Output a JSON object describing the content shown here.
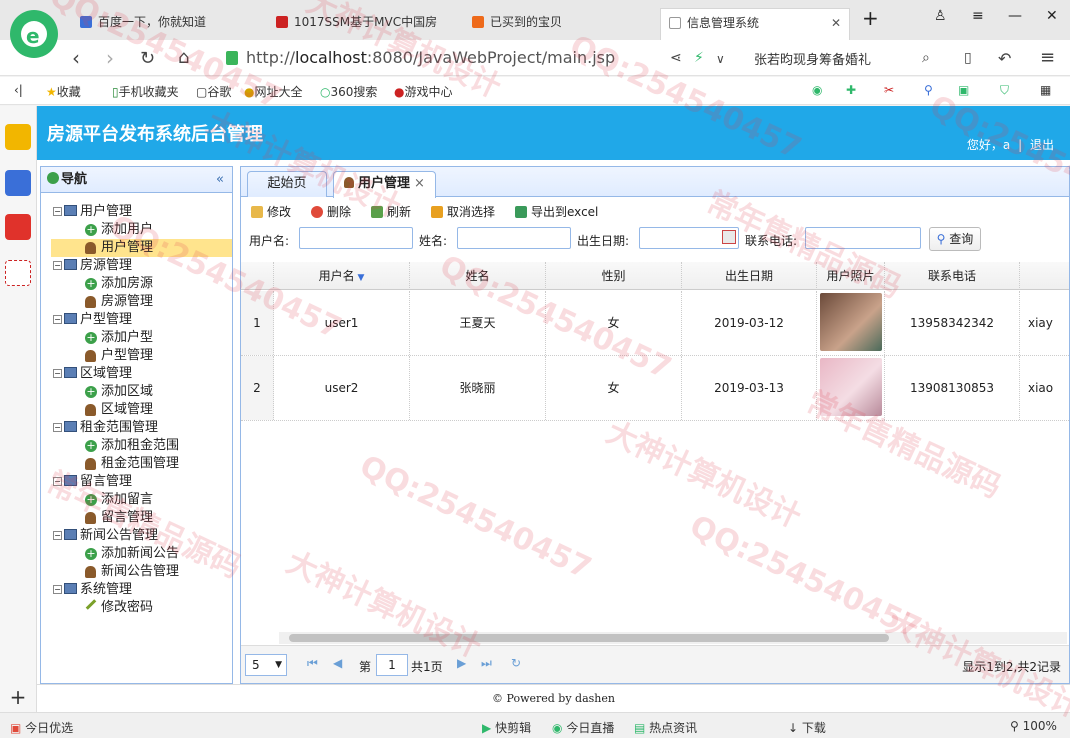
{
  "browser": {
    "tabs": [
      {
        "label": "百度一下，你就知道",
        "color": "#3a6fd8"
      },
      {
        "label": "1017SSM基于MVC中国房",
        "color": "#cc2222"
      },
      {
        "label": "已买到的宝贝",
        "color": "#ee6a1a"
      },
      {
        "label": "信息管理系统",
        "color": "#999999"
      }
    ],
    "url_prefix": "http://",
    "url_host": "localhost",
    "url_rest": ":8080/JavaWebProject/main.jsp",
    "search_suggestion": "张若昀现身筹备婚礼",
    "bookmarks": [
      "收藏",
      "手机收藏夹",
      "谷歌",
      "网址大全",
      "360搜索",
      "游戏中心"
    ]
  },
  "app": {
    "title": "房源平台发布系统后台管理",
    "greeting": "您好，a",
    "separator": "|",
    "logout": "退出"
  },
  "nav": {
    "header": "导航",
    "collapse": "«",
    "groups": [
      {
        "label": "用户管理",
        "children": [
          {
            "label": "添加用户",
            "icon": "add"
          },
          {
            "label": "用户管理",
            "icon": "user",
            "selected": true
          }
        ]
      },
      {
        "label": "房源管理",
        "children": [
          {
            "label": "添加房源",
            "icon": "add"
          },
          {
            "label": "房源管理",
            "icon": "user"
          }
        ]
      },
      {
        "label": "户型管理",
        "children": [
          {
            "label": "添加户型",
            "icon": "add"
          },
          {
            "label": "户型管理",
            "icon": "user"
          }
        ]
      },
      {
        "label": "区域管理",
        "children": [
          {
            "label": "添加区域",
            "icon": "add"
          },
          {
            "label": "区域管理",
            "icon": "user"
          }
        ]
      },
      {
        "label": "租金范围管理",
        "children": [
          {
            "label": "添加租金范围",
            "icon": "add"
          },
          {
            "label": "租金范围管理",
            "icon": "user"
          }
        ]
      },
      {
        "label": "留言管理",
        "children": [
          {
            "label": "添加留言",
            "icon": "add"
          },
          {
            "label": "留言管理",
            "icon": "user"
          }
        ]
      },
      {
        "label": "新闻公告管理",
        "children": [
          {
            "label": "添加新闻公告",
            "icon": "add"
          },
          {
            "label": "新闻公告管理",
            "icon": "user"
          }
        ]
      },
      {
        "label": "系统管理",
        "children": [
          {
            "label": "修改密码",
            "icon": "pen"
          }
        ]
      }
    ]
  },
  "tabs": {
    "home": "起始页",
    "current": "用户管理",
    "close": "×"
  },
  "toolbar": {
    "edit": "修改",
    "delete": "删除",
    "refresh": "刷新",
    "unselect": "取消选择",
    "export": "导出到excel"
  },
  "filters": {
    "username": "用户名:",
    "name": "姓名:",
    "birth": "出生日期:",
    "phone": "联系电话:",
    "query": "查询"
  },
  "grid": {
    "columns": [
      "用户名",
      "姓名",
      "性别",
      "出生日期",
      "用户照片",
      "联系电话",
      ""
    ],
    "rows": [
      {
        "num": "1",
        "username": "user1",
        "name": "王夏天",
        "gender": "女",
        "birth": "2019-03-12",
        "phone": "13958342342",
        "extra": "xiay"
      },
      {
        "num": "2",
        "username": "user2",
        "name": "张晓丽",
        "gender": "女",
        "birth": "2019-03-13",
        "phone": "13908130853",
        "extra": "xiao"
      }
    ]
  },
  "pager": {
    "size": "5",
    "page_prefix": "第",
    "page": "1",
    "page_suffix": "共1页",
    "info": "显示1到2,共2记录"
  },
  "footer": "© Powered by dashen",
  "statusbar": [
    "今日优选",
    "快剪辑",
    "今日直播",
    "热点资讯",
    "下载",
    "100%"
  ],
  "watermarks": [
    "QQ:254540457",
    "大神计算机设计",
    "常年售精品源码"
  ]
}
